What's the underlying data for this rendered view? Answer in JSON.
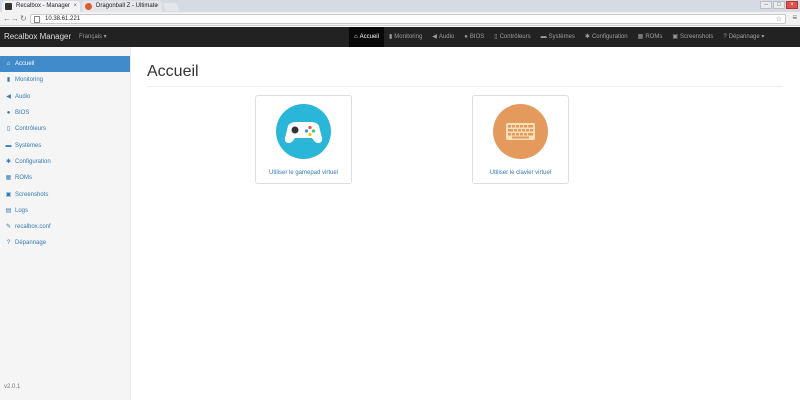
{
  "browser": {
    "tabs": [
      {
        "title": "Recalbox - Manager",
        "active": true
      },
      {
        "title": "Dragonball Z - Ultimate",
        "active": false
      }
    ],
    "url": "10.38.61.221"
  },
  "navbar": {
    "brand": "Recalbox Manager",
    "language": "Français ▾",
    "items": [
      {
        "label": "Accueil",
        "icon": "home-icon",
        "glyph": "⌂",
        "active": true
      },
      {
        "label": "Monitoring",
        "icon": "bar-chart-icon",
        "glyph": "▮",
        "active": false
      },
      {
        "label": "Audio",
        "icon": "speaker-icon",
        "glyph": "◀",
        "active": false
      },
      {
        "label": "BIOS",
        "icon": "globe-icon",
        "glyph": "●",
        "active": false
      },
      {
        "label": "Contrôleurs",
        "icon": "phone-icon",
        "glyph": "▯",
        "active": false
      },
      {
        "label": "Systèmes",
        "icon": "hdd-icon",
        "glyph": "▬",
        "active": false
      },
      {
        "label": "Configuration",
        "icon": "gear-icon",
        "glyph": "✱",
        "active": false
      },
      {
        "label": "ROMs",
        "icon": "film-icon",
        "glyph": "▦",
        "active": false
      },
      {
        "label": "Screenshots",
        "icon": "picture-icon",
        "glyph": "▣",
        "active": false
      },
      {
        "label": "Dépannage ▾",
        "icon": "question-icon",
        "glyph": "?",
        "active": false
      }
    ]
  },
  "sidebar": {
    "items": [
      {
        "label": "Accueil",
        "icon": "home-icon",
        "glyph": "⌂",
        "active": true
      },
      {
        "label": "Monitoring",
        "icon": "bar-chart-icon",
        "glyph": "▮",
        "active": false
      },
      {
        "label": "Audio",
        "icon": "speaker-icon",
        "glyph": "◀",
        "active": false
      },
      {
        "label": "BIOS",
        "icon": "globe-icon",
        "glyph": "●",
        "active": false
      },
      {
        "label": "Contrôleurs",
        "icon": "phone-icon",
        "glyph": "▯",
        "active": false
      },
      {
        "label": "Systèmes",
        "icon": "hdd-icon",
        "glyph": "▬",
        "active": false
      },
      {
        "label": "Configuration",
        "icon": "gear-icon",
        "glyph": "✱",
        "active": false
      },
      {
        "label": "ROMs",
        "icon": "film-icon",
        "glyph": "▦",
        "active": false
      },
      {
        "label": "Screenshots",
        "icon": "picture-icon",
        "glyph": "▣",
        "active": false
      },
      {
        "label": "Logs",
        "icon": "file-icon",
        "glyph": "▤",
        "active": false
      },
      {
        "label": "recalbox.conf",
        "icon": "pencil-icon",
        "glyph": "✎",
        "active": false
      },
      {
        "label": "Dépannage",
        "icon": "question-icon",
        "glyph": "?",
        "active": false
      }
    ],
    "version": "v2.0.1"
  },
  "main": {
    "title": "Accueil",
    "cards": [
      {
        "label": "Utiliser le gamepad virtuel",
        "icon": "gamepad-icon",
        "color": "#29b6d8"
      },
      {
        "label": "Utiliser le clavier virtuel",
        "icon": "keyboard-icon",
        "color": "#e39a5c"
      }
    ]
  },
  "colors": {
    "navbar": "#222222",
    "sidebar_active": "#428bca",
    "link": "#337ab7"
  }
}
